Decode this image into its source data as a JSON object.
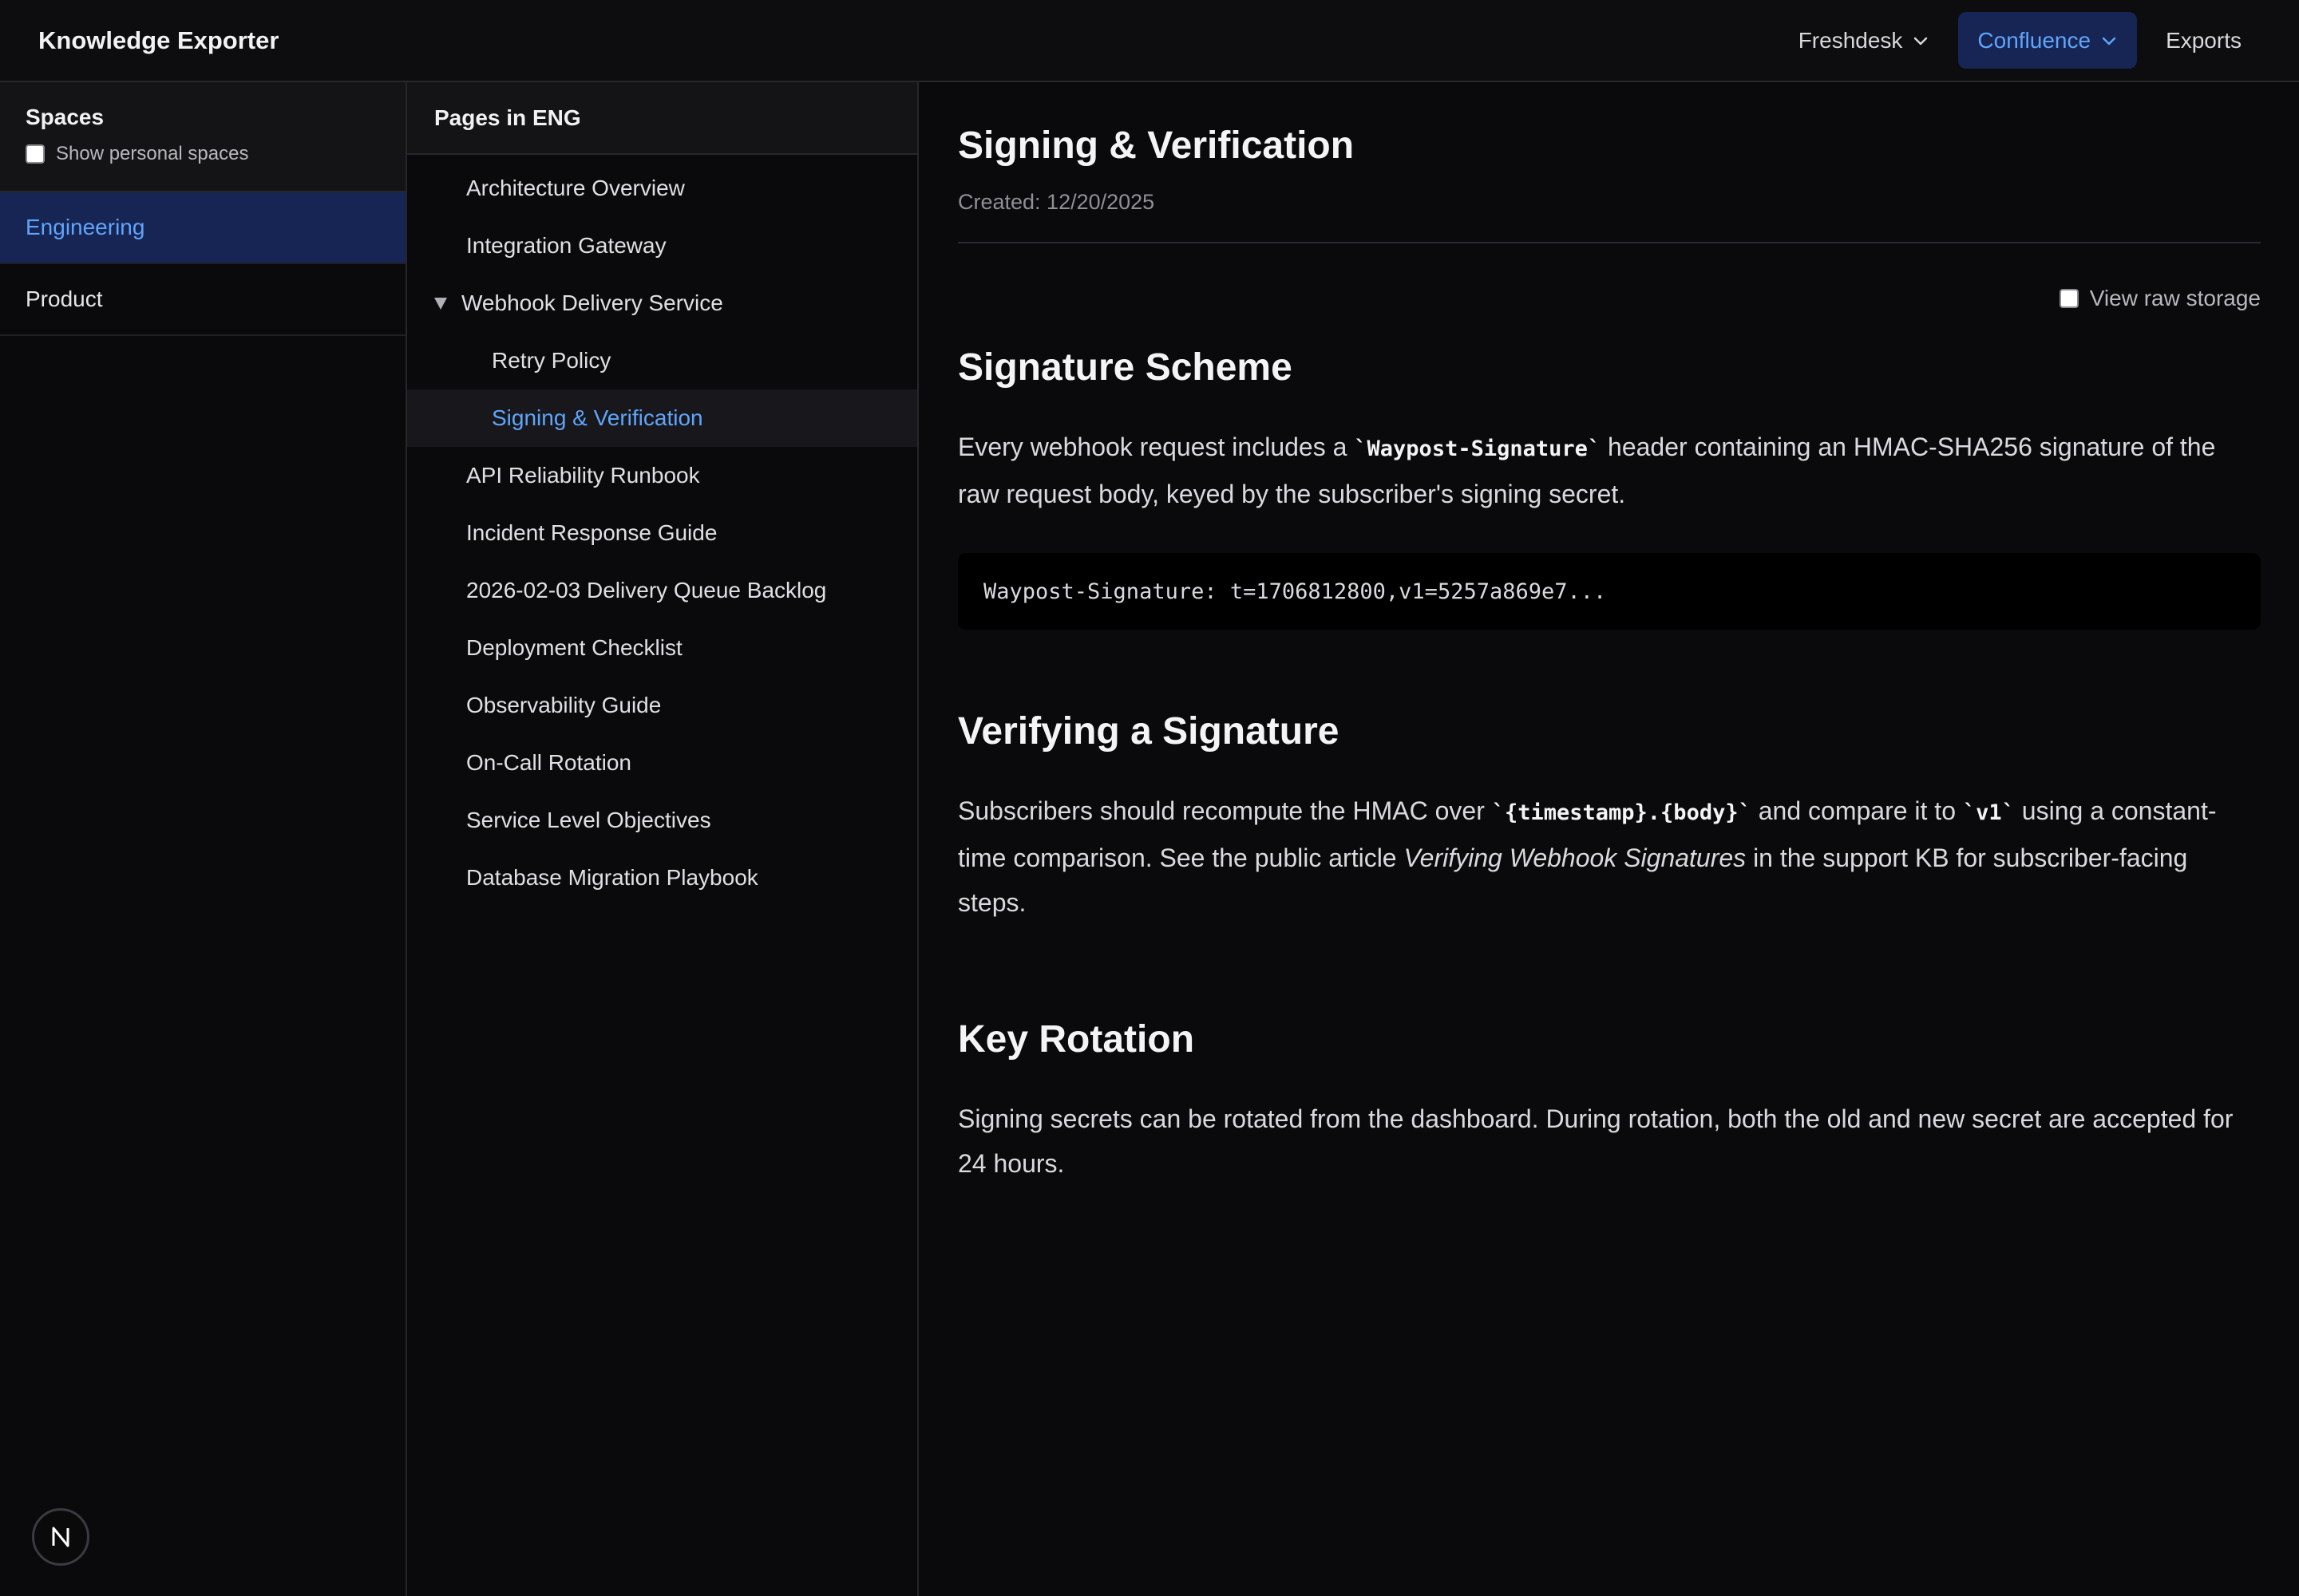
{
  "app": {
    "title": "Knowledge Exporter"
  },
  "nav": {
    "items": [
      {
        "label": "Freshdesk",
        "icon": "chevron-down-icon"
      },
      {
        "label": "Confluence",
        "icon": "chevron-down-icon",
        "active": true
      },
      {
        "label": "Exports"
      }
    ]
  },
  "spaces": {
    "title": "Spaces",
    "show_personal_label": "Show personal spaces",
    "show_personal_checked": false,
    "items": [
      {
        "label": "Engineering",
        "active": true
      },
      {
        "label": "Product"
      }
    ]
  },
  "pages": {
    "title": "Pages in ENG",
    "items": [
      {
        "label": "Architecture Overview"
      },
      {
        "label": "Integration Gateway"
      },
      {
        "label": "Webhook Delivery Service",
        "expanded": true,
        "icon": "triangle-down-icon"
      },
      {
        "label": "Retry Policy",
        "child": true
      },
      {
        "label": "Signing & Verification",
        "child": true,
        "active": true
      },
      {
        "label": "API Reliability Runbook"
      },
      {
        "label": "Incident Response Guide"
      },
      {
        "label": "2026-02-03 Delivery Queue Backlog"
      },
      {
        "label": "Deployment Checklist"
      },
      {
        "label": "Observability Guide"
      },
      {
        "label": "On-Call Rotation"
      },
      {
        "label": "Service Level Objectives"
      },
      {
        "label": "Database Migration Playbook"
      }
    ]
  },
  "content": {
    "title": "Signing & Verification",
    "created": "Created: 12/20/2025",
    "raw_storage_label": "View raw storage",
    "raw_storage_checked": false,
    "sections": {
      "scheme": {
        "heading": "Signature Scheme",
        "p1_a": "Every webhook request includes a ",
        "p1_code": "`Waypost-Signature`",
        "p1_b": " header containing an HMAC-SHA256 signature of the raw request body, keyed by the subscriber's signing secret.",
        "code_block": "Waypost-Signature: t=1706812800,v1=5257a869e7..."
      },
      "verify": {
        "heading": "Verifying a Signature",
        "p_a": "Subscribers should recompute the HMAC over ",
        "p_code1": "`{timestamp}.{body}`",
        "p_b": " and compare it to ",
        "p_code2": "`v1`",
        "p_c": " using a constant-time comparison. See the public article ",
        "p_em": "Verifying Webhook Signatures",
        "p_d": " in the support KB for subscriber-facing steps."
      },
      "rotate": {
        "heading": "Key Rotation",
        "p": "Signing secrets can be rotated from the dashboard. During rotation, both the old and new secret are accepted for 24 hours."
      }
    }
  },
  "badge": {
    "icon": "n-logo-icon"
  },
  "colors": {
    "accent": "#60a5fa",
    "accent_bg": "#172554",
    "background": "#0a0a0c"
  }
}
